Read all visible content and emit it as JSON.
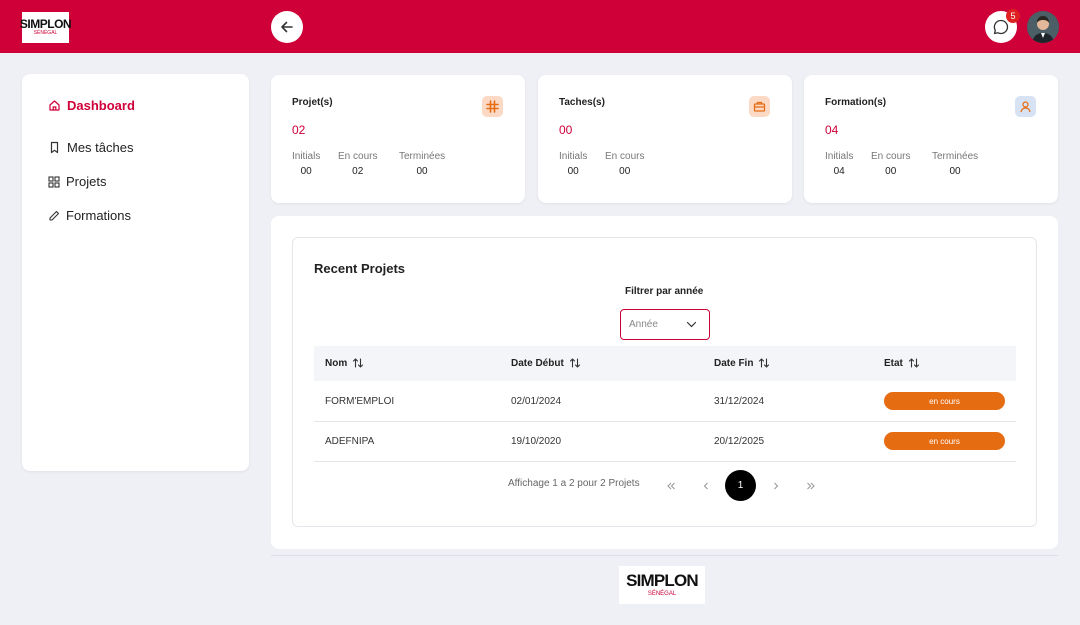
{
  "brand": {
    "name": "SIMPLON",
    "sub": "SÉNÉGAL",
    "color": "#cf0038"
  },
  "header": {
    "notification_count": "5"
  },
  "sidebar": {
    "items": [
      {
        "label": "Dashboard",
        "icon": "home-icon",
        "active": true
      },
      {
        "label": "Mes tâches",
        "icon": "bookmark-icon"
      },
      {
        "label": "Projets",
        "icon": "grid-icon"
      },
      {
        "label": "Formations",
        "icon": "pencil-icon"
      }
    ]
  },
  "cards": [
    {
      "title": "Projet(s)",
      "count": "02",
      "icon": "slack-icon",
      "stats": [
        {
          "label": "Initials",
          "value": "00"
        },
        {
          "label": "En cours",
          "value": "02"
        },
        {
          "label": "Terminées",
          "value": "00"
        }
      ]
    },
    {
      "title": "Taches(s)",
      "count": "00",
      "icon": "briefcase-icon",
      "stats": [
        {
          "label": "Initials",
          "value": "00"
        },
        {
          "label": "En cours",
          "value": "00"
        }
      ]
    },
    {
      "title": "Formation(s)",
      "count": "04",
      "icon": "user-icon",
      "stats": [
        {
          "label": "Initials",
          "value": "04"
        },
        {
          "label": "En cours",
          "value": "00"
        },
        {
          "label": "Terminées",
          "value": "00"
        }
      ]
    }
  ],
  "recent": {
    "title": "Recent Projets",
    "filter_label": "Filtrer par année",
    "filter_placeholder": "Année",
    "columns": [
      "Nom",
      "Date Début",
      "Date Fin",
      "Etat"
    ],
    "rows": [
      {
        "nom": "FORM'EMPLOI",
        "debut": "02/01/2024",
        "fin": "31/12/2024",
        "etat": "en cours"
      },
      {
        "nom": "ADEFNIPA",
        "debut": "19/10/2020",
        "fin": "20/12/2025",
        "etat": "en cours"
      }
    ],
    "pagination": {
      "info": "Affichage 1 a 2 pour 2 Projets",
      "current_page": "1"
    }
  }
}
